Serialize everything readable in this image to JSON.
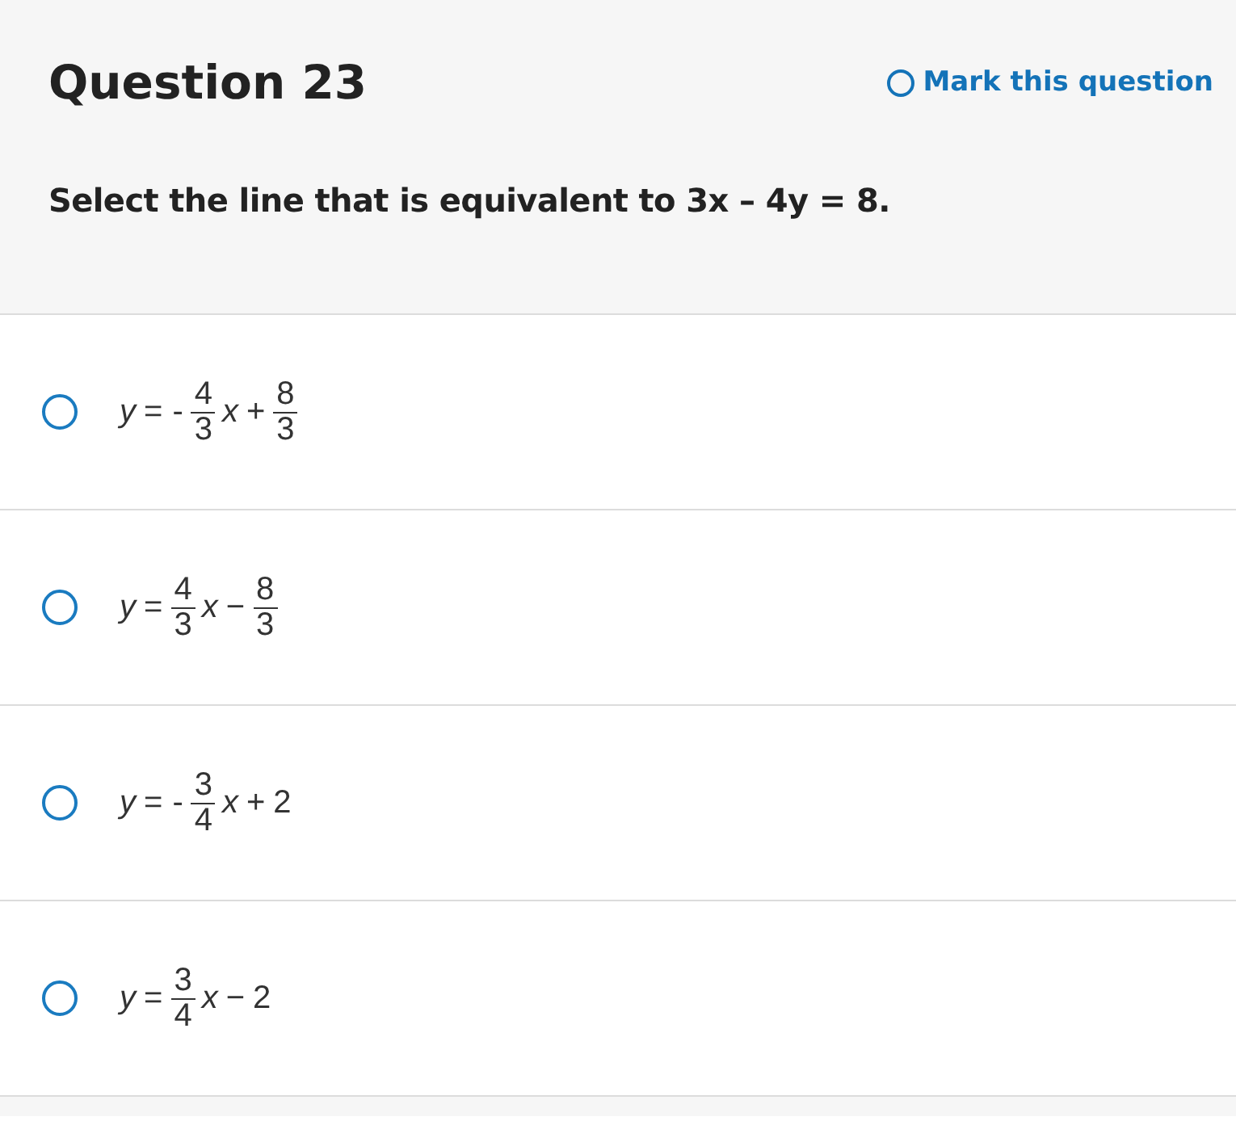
{
  "question": {
    "title": "Question 23",
    "mark": {
      "label": "Mark this question",
      "checked": false
    },
    "prompt": "Select the line that is equivalent to 3x – 4y = 8."
  },
  "options": [
    {
      "selected": false,
      "parts": [
        {
          "kind": "var",
          "text": "y"
        },
        {
          "kind": "op",
          "text": "="
        },
        {
          "kind": "op",
          "text": "-"
        },
        {
          "kind": "frac",
          "num": "4",
          "den": "3"
        },
        {
          "kind": "var",
          "text": "x"
        },
        {
          "kind": "op",
          "text": "+"
        },
        {
          "kind": "frac",
          "num": "8",
          "den": "3"
        }
      ]
    },
    {
      "selected": false,
      "parts": [
        {
          "kind": "var",
          "text": "y"
        },
        {
          "kind": "op",
          "text": "="
        },
        {
          "kind": "frac",
          "num": "4",
          "den": "3"
        },
        {
          "kind": "var",
          "text": "x"
        },
        {
          "kind": "op",
          "text": "−"
        },
        {
          "kind": "frac",
          "num": "8",
          "den": "3"
        }
      ]
    },
    {
      "selected": false,
      "parts": [
        {
          "kind": "var",
          "text": "y"
        },
        {
          "kind": "op",
          "text": "="
        },
        {
          "kind": "op",
          "text": "-"
        },
        {
          "kind": "frac",
          "num": "3",
          "den": "4"
        },
        {
          "kind": "var",
          "text": "x"
        },
        {
          "kind": "op",
          "text": "+"
        },
        {
          "kind": "num",
          "text": "2"
        }
      ]
    },
    {
      "selected": false,
      "parts": [
        {
          "kind": "var",
          "text": "y"
        },
        {
          "kind": "op",
          "text": "="
        },
        {
          "kind": "frac",
          "num": "3",
          "den": "4"
        },
        {
          "kind": "var",
          "text": "x"
        },
        {
          "kind": "op",
          "text": "−"
        },
        {
          "kind": "num",
          "text": "2"
        }
      ]
    }
  ]
}
